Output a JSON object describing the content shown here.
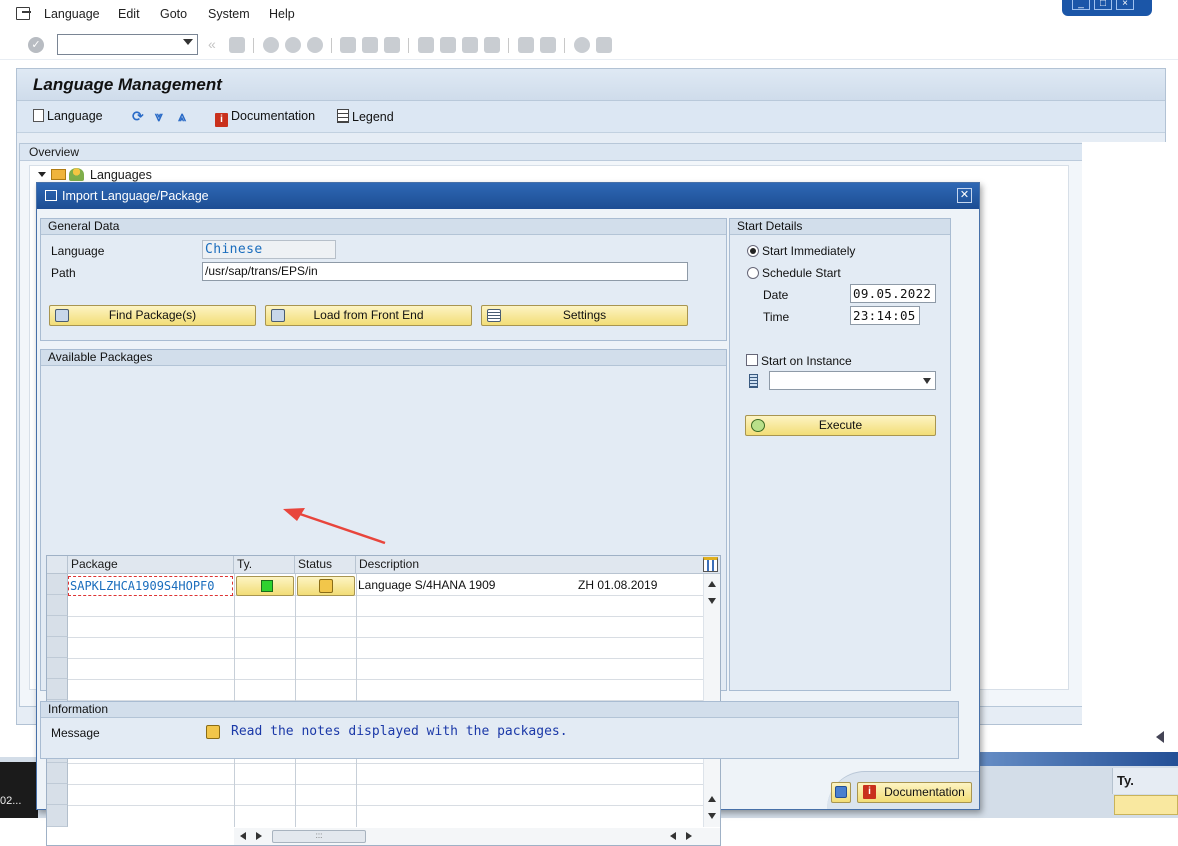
{
  "menu": {
    "items": [
      "Language",
      "Edit",
      "Goto",
      "System",
      "Help"
    ]
  },
  "toolbar": {
    "command_field": ""
  },
  "main": {
    "title": "Language Management",
    "app_toolbar": {
      "language": "Language",
      "documentation": "Documentation",
      "legend": "Legend"
    },
    "overview": {
      "label": "Overview",
      "tree_root": "Languages"
    }
  },
  "dialog": {
    "title": "Import Language/Package",
    "general": {
      "label": "General Data",
      "language_label": "Language",
      "language_value": "Chinese",
      "path_label": "Path",
      "path_value": "/usr/sap/trans/EPS/in",
      "find_btn": "Find Package(s)",
      "load_btn": "Load from Front End",
      "settings_btn": "Settings"
    },
    "packages": {
      "label": "Available Packages",
      "columns": [
        "Package",
        "Ty.",
        "Status",
        "Description"
      ],
      "rows": [
        {
          "package": "SAPKLZHCA1909S4HOPF0",
          "description": "Language S/4HANA 1909",
          "extra": "ZH 01.08.2019"
        }
      ]
    },
    "start": {
      "label": "Start Details",
      "immediately": "Start Immediately",
      "schedule": "Schedule Start",
      "date_label": "Date",
      "date_value": "09.05.2022",
      "time_label": "Time",
      "time_value": "23:14:05",
      "instance": "Start on Instance",
      "instance_value": "",
      "execute_btn": "Execute"
    },
    "info": {
      "label": "Information",
      "message_label": "Message",
      "message_text": "Read the notes displayed with the packages."
    },
    "footer": {
      "documentation_btn": "Documentation"
    }
  },
  "background": {
    "bottom_left_text": "02...",
    "bottom_right_header": "Ty."
  },
  "colors": {
    "accent_blue": "#1d4d93",
    "button_yellow": "#f2dd77",
    "link_blue": "#1a6dbd",
    "annotation_red": "#e8453c"
  }
}
